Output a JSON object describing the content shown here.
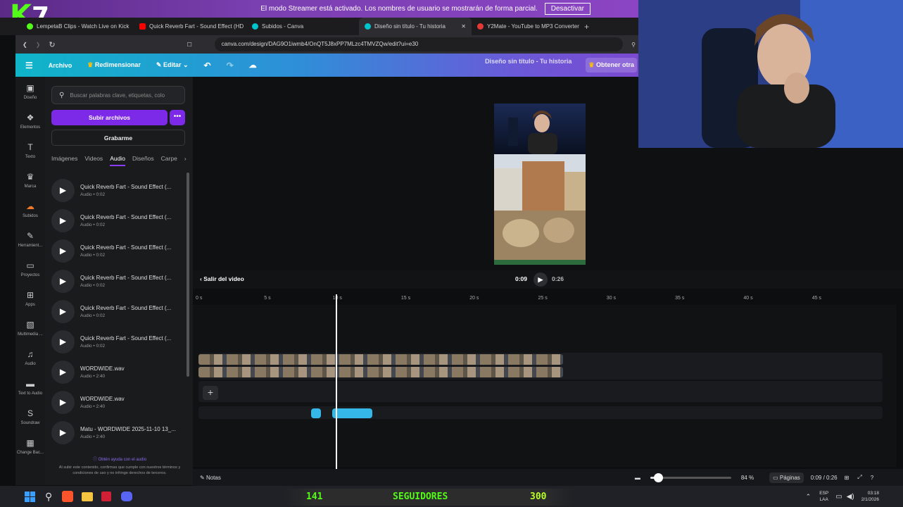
{
  "banner": {
    "text": "El modo Streamer está activado. Los nombres de usuario se mostrarán de forma parcial.",
    "button": "Desactivar"
  },
  "overlay": {
    "logo_k": "K",
    "logo_num": "7"
  },
  "browser": {
    "tabs": [
      {
        "label": "LempetaB Clips - Watch Live on Kick",
        "favicon_color": "#53fc18"
      },
      {
        "label": "Quick Reverb Fart - Sound Effect (HD",
        "favicon_color": "#ff0000"
      },
      {
        "label": "Subidos - Canva",
        "favicon_color": "#00c4cc"
      },
      {
        "label": "Diseño sin título - Tu historia",
        "favicon_color": "#00c4cc"
      },
      {
        "label": "Y2Mate - YouTube to MP3 Converter",
        "favicon_color": "#e53935"
      }
    ],
    "url": "canva.com/design/DAG9O1iwmb4/OnQT5J8xPP7MLzc4TMVZQw/edit?ui=e30"
  },
  "canva_toolbar": {
    "file": "Archivo",
    "resize": "Redimensionar",
    "edit": "Editar",
    "doc_title": "Diseño sin título - Tu historia",
    "get_more": "Obtener otra"
  },
  "rail": [
    {
      "label": "Diseño",
      "icon": "layout-icon"
    },
    {
      "label": "Elementos",
      "icon": "shapes-icon"
    },
    {
      "label": "Texto",
      "icon": "text-icon"
    },
    {
      "label": "Marca",
      "icon": "crown-icon"
    },
    {
      "label": "Subidos",
      "icon": "cloud-upload-icon"
    },
    {
      "label": "Herramient...",
      "icon": "pen-icon"
    },
    {
      "label": "Proyectos",
      "icon": "folder-icon"
    },
    {
      "label": "Apps",
      "icon": "apps-icon"
    },
    {
      "label": "Multimedia ...",
      "icon": "image-icon"
    },
    {
      "label": "Audio",
      "icon": "music-icon"
    },
    {
      "label": "Text to Audio",
      "icon": "speaker-icon"
    },
    {
      "label": "Soundraw",
      "icon": "soundraw-icon"
    },
    {
      "label": "Change Bac...",
      "icon": "background-icon"
    }
  ],
  "panel": {
    "search_placeholder": "Buscar palabras clave, etiquetas, colo",
    "upload": "Subir archivos",
    "more": "•••",
    "record": "Grabarme",
    "tabs": [
      "Imágenes",
      "Videos",
      "Audio",
      "Diseños",
      "Carpe"
    ],
    "active_tab": "Audio",
    "items": [
      {
        "title": "Quick Reverb Fart - Sound Effect (...",
        "meta": "Audio • 0:02"
      },
      {
        "title": "Quick Reverb Fart - Sound Effect (...",
        "meta": "Audio • 0:02"
      },
      {
        "title": "Quick Reverb Fart - Sound Effect (...",
        "meta": "Audio • 0:02"
      },
      {
        "title": "Quick Reverb Fart - Sound Effect (...",
        "meta": "Audio • 0:02"
      },
      {
        "title": "Quick Reverb Fart - Sound Effect (...",
        "meta": "Audio • 0:02"
      },
      {
        "title": "Quick Reverb Fart - Sound Effect (...",
        "meta": "Audio • 0:02"
      },
      {
        "title": "WORDWIDE.wav",
        "meta": "Audio • 2:40"
      },
      {
        "title": "WORDWIDE.wav",
        "meta": "Audio • 2:40"
      },
      {
        "title": "Matu - WORDWIDE 2025-11-10 13_...",
        "meta": "Audio • 2:40"
      }
    ],
    "footer_link": "Obtén ayuda con el audio",
    "footer_note": "Al subir este contenido, confirmas que cumple con nuestros términos y condiciones de uso y no infringe derechos de terceros."
  },
  "player": {
    "exit": "Salir del video",
    "current": "0:09",
    "total": "0:26"
  },
  "ruler": [
    "0 s",
    "5 s",
    "10 s",
    "15 s",
    "20 s",
    "25 s",
    "30 s",
    "35 s",
    "40 s",
    "45 s"
  ],
  "playhead_seconds": 10,
  "bottom": {
    "notes": "Notas",
    "zoom": "84 %",
    "zoom_level": 0.1,
    "pages": "Páginas",
    "time": "0:09 / 0:26"
  },
  "taskbar": {
    "lang": "ESP",
    "layout": "LAA",
    "clock": "03:18",
    "date": "2/1/2026"
  },
  "followers": {
    "current": "141",
    "label": "SEGUIDORES",
    "goal": "300"
  }
}
